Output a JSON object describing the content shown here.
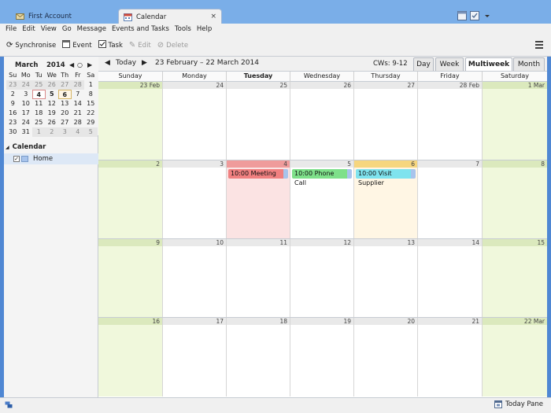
{
  "tabs": [
    {
      "label": "First Account",
      "icon": "mail-icon"
    },
    {
      "label": "Calendar",
      "icon": "calendar-icon",
      "close": "×"
    }
  ],
  "menu": [
    "File",
    "Edit",
    "View",
    "Go",
    "Message",
    "Events and Tasks",
    "Tools",
    "Help"
  ],
  "toolbar": {
    "synchronise": "Synchronise",
    "event": "Event",
    "task": "Task",
    "edit": "Edit",
    "delete": "Delete"
  },
  "minical": {
    "month": "March",
    "year": "2014",
    "prev": "◀",
    "today": "○",
    "next": "▶",
    "dow": [
      "Su",
      "Mo",
      "Tu",
      "We",
      "Th",
      "Fr",
      "Sa"
    ],
    "weeks": [
      [
        "23",
        "24",
        "25",
        "26",
        "27",
        "28",
        "1"
      ],
      [
        "2",
        "3",
        "4",
        "5",
        "6",
        "7",
        "8"
      ],
      [
        "9",
        "10",
        "11",
        "12",
        "13",
        "14",
        "15"
      ],
      [
        "16",
        "17",
        "18",
        "19",
        "20",
        "21",
        "22"
      ],
      [
        "23",
        "24",
        "25",
        "26",
        "27",
        "28",
        "29"
      ],
      [
        "30",
        "31",
        "1",
        "2",
        "3",
        "4",
        "5"
      ]
    ]
  },
  "calendars": {
    "heading": "Calendar",
    "items": [
      {
        "name": "Home",
        "checked": "✓",
        "color": "#a8c4ec"
      }
    ]
  },
  "nav": {
    "prev": "◀",
    "today": "Today",
    "next": "▶",
    "range": "23 February – 22 March 2014",
    "cws": "CWs: 9-12"
  },
  "views": [
    "Day",
    "Week",
    "Multiweek",
    "Month"
  ],
  "active_view": "Multiweek",
  "day_headers": [
    "Sunday",
    "Monday",
    "Tuesday",
    "Wednesday",
    "Thursday",
    "Friday",
    "Saturday"
  ],
  "weeks": [
    [
      "23 Feb",
      "24",
      "25",
      "26",
      "27",
      "28 Feb",
      "1 Mar"
    ],
    [
      "2",
      "3",
      "4",
      "5",
      "6",
      "7",
      "8"
    ],
    [
      "9",
      "10",
      "11",
      "12",
      "13",
      "14",
      "15"
    ],
    [
      "16",
      "17",
      "18",
      "19",
      "20",
      "21",
      "22 Mar"
    ]
  ],
  "events": [
    {
      "label": "10:00 Meeting",
      "week": 1,
      "day": 2,
      "color": "#f08080"
    },
    {
      "label": "10:00 Phone Call",
      "week": 1,
      "day": 3,
      "color": "#7ee08a"
    },
    {
      "label": "10:00 Visit Supplier",
      "week": 1,
      "day": 4,
      "color": "#7fe3ee"
    }
  ],
  "status": {
    "today_pane": "Today Pane"
  }
}
